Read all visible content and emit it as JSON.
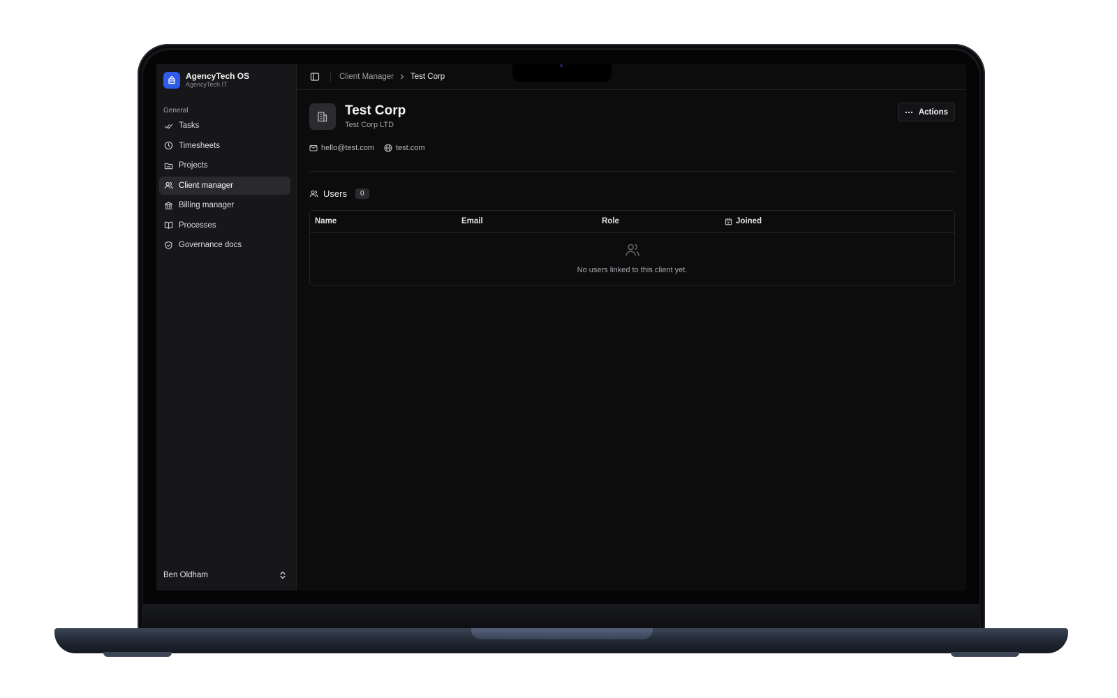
{
  "sidebar": {
    "brand_name": "AgencyTech OS",
    "brand_sub": "AgencyTech IT",
    "group_label": "General",
    "items": [
      {
        "label": "Tasks",
        "icon": "check-icon",
        "active": false
      },
      {
        "label": "Timesheets",
        "icon": "clock-icon",
        "active": false
      },
      {
        "label": "Projects",
        "icon": "folder-icon",
        "active": false
      },
      {
        "label": "Client manager",
        "icon": "users-icon",
        "active": true
      },
      {
        "label": "Billing manager",
        "icon": "bank-icon",
        "active": false
      },
      {
        "label": "Processes",
        "icon": "book-icon",
        "active": false
      },
      {
        "label": "Governance docs",
        "icon": "shield-icon",
        "active": false
      }
    ],
    "user_name": "Ben Oldham"
  },
  "breadcrumb": {
    "parent": "Client Manager",
    "current": "Test Corp"
  },
  "client": {
    "name": "Test Corp",
    "legal_name": "Test Corp LTD",
    "email": "hello@test.com",
    "website": "test.com"
  },
  "actions_label": "Actions",
  "users": {
    "title": "Users",
    "count": "0",
    "columns": [
      "Name",
      "Email",
      "Role",
      "Joined"
    ],
    "empty_text": "No users linked to this client yet."
  },
  "colors": {
    "accent": "#2f5bea",
    "background": "#0c0c0d",
    "sidebar": "#17171a"
  }
}
